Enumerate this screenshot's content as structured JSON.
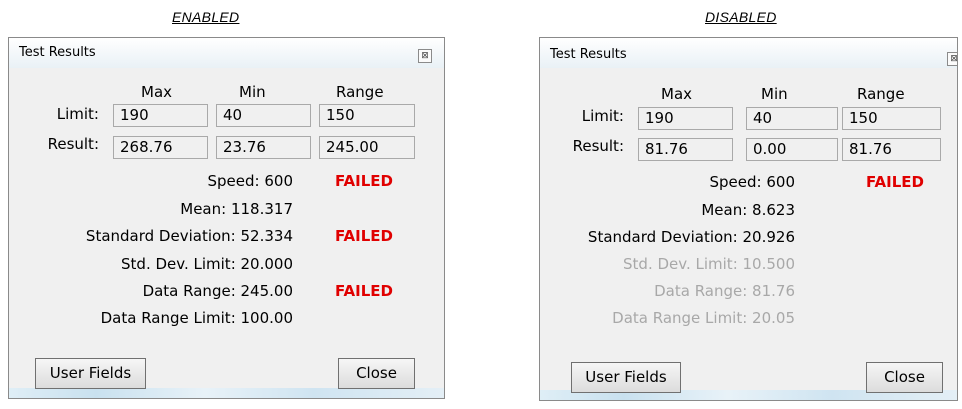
{
  "captions": {
    "enabled": "ENABLED",
    "disabled": "DISABLED"
  },
  "headers": {
    "max": "Max",
    "min": "Min",
    "range": "Range"
  },
  "row_labels": {
    "limit": "Limit:",
    "result": "Result:"
  },
  "buttons": {
    "user_fields": "User Fields",
    "close": "Close"
  },
  "close_icon_glyph": "⊠",
  "failed_color": "#e00000",
  "disabled_text_color": "#a8a8a8",
  "windows": {
    "enabled": {
      "title": "Test Results",
      "limit": {
        "max": "190",
        "min": "40",
        "range": "150"
      },
      "result": {
        "max": "268.76",
        "min": "23.76",
        "range": "245.00"
      },
      "stats": [
        {
          "text": "Speed: 600",
          "failed": "FAILED"
        },
        {
          "text": "Mean: 118.317"
        },
        {
          "text": "Standard Deviation: 52.334",
          "failed": "FAILED"
        },
        {
          "text": "Std. Dev. Limit: 20.000"
        },
        {
          "text": "Data Range: 245.00",
          "failed": "FAILED"
        },
        {
          "text": "Data Range Limit: 100.00"
        }
      ]
    },
    "disabled": {
      "title": "Test Results",
      "limit": {
        "max": "190",
        "min": "40",
        "range": "150"
      },
      "result": {
        "max": "81.76",
        "min": "0.00",
        "range": "81.76"
      },
      "stats": [
        {
          "text": "Speed: 600",
          "failed": "FAILED"
        },
        {
          "text": "Mean: 8.623"
        },
        {
          "text": "Standard Deviation: 20.926"
        },
        {
          "text": "Std. Dev. Limit: 10.500"
        },
        {
          "text": "Data Range: 81.76"
        },
        {
          "text": "Data Range Limit: 20.05"
        }
      ]
    }
  }
}
